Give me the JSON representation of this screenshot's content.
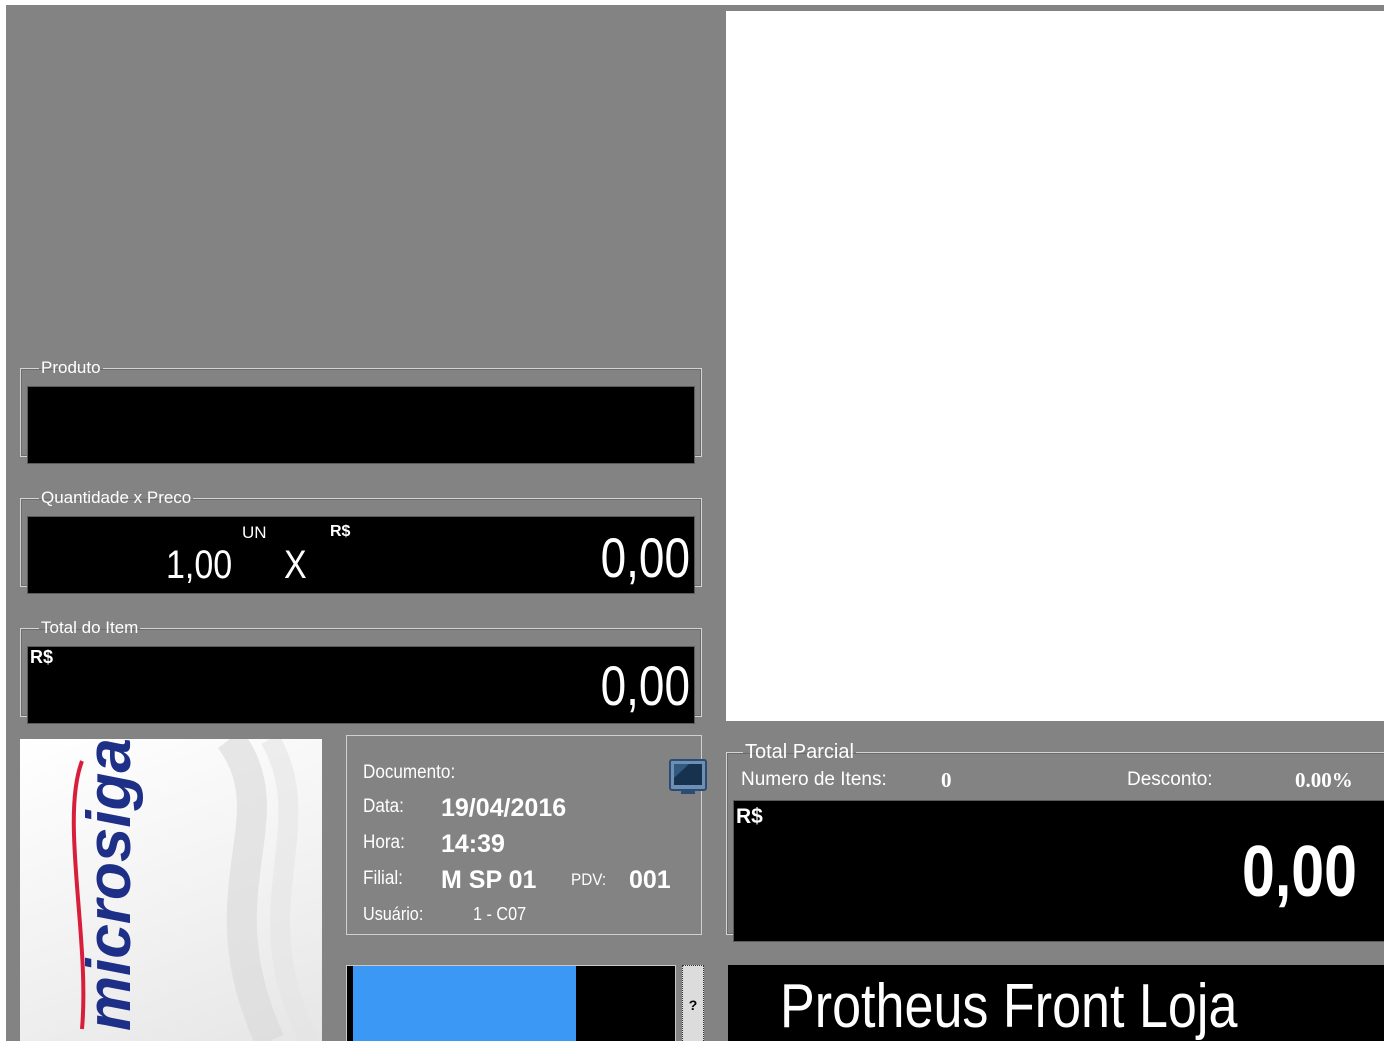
{
  "produto": {
    "legend": "Produto",
    "value": ""
  },
  "quantidade": {
    "legend": "Quantidade x Preco",
    "qty": "1,00",
    "unit": "UN",
    "times": "X",
    "currency": "R$",
    "price": "0,00"
  },
  "total_item": {
    "legend": "Total do Item",
    "currency": "R$",
    "value": "0,00"
  },
  "logo": {
    "text": "microsiga"
  },
  "info": {
    "documento_label": "Documento:",
    "data_label": "Data:",
    "data_value": "19/04/2016",
    "hora_label": "Hora:",
    "hora_value": "14:39",
    "filial_label": "Filial:",
    "filial_value": "M SP 01",
    "pdv_label": "PDV:",
    "pdv_value": "001",
    "usuario_label": "Usuário:",
    "usuario_value": "1 - C07",
    "monitor_icon": "monitor-icon"
  },
  "total_parcial": {
    "legend": "Total Parcial",
    "itens_label": "Numero de Itens:",
    "itens_value": "0",
    "desconto_label": "Desconto:",
    "desconto_value": "0.00%",
    "currency": "R$",
    "value": "0,00"
  },
  "progress": {
    "fraction": 0.7
  },
  "help": {
    "label": "?"
  },
  "banner": {
    "text": "Protheus Front Loja"
  },
  "colors": {
    "background": "#838383",
    "display": "#000000",
    "progress": "#3b98f5",
    "logo_red": "#d81e3a",
    "logo_blue": "#1d2f86"
  }
}
